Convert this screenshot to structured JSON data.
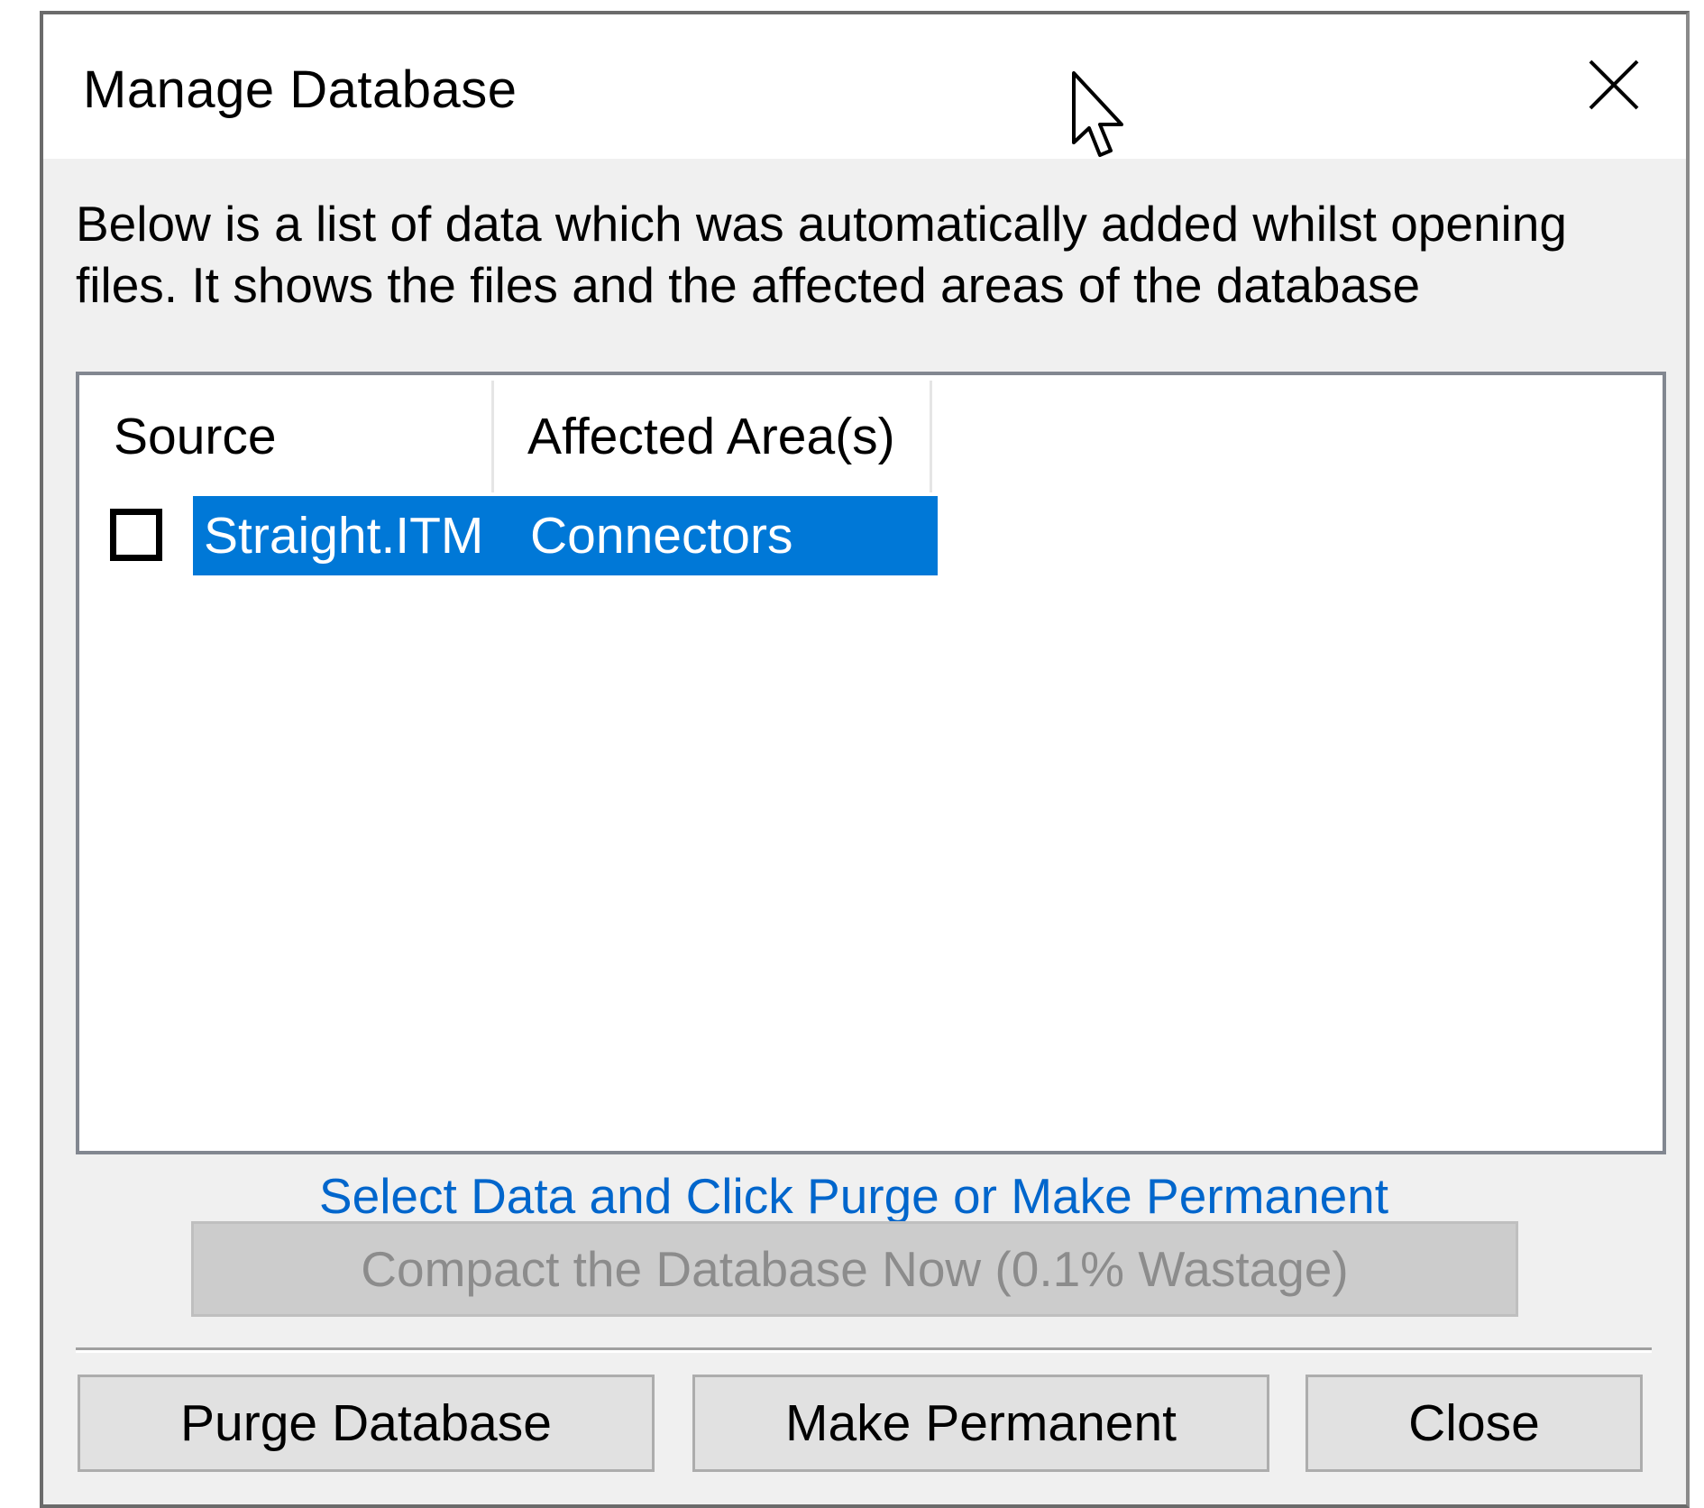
{
  "dialog": {
    "title": "Manage Database",
    "description": "Below is a list of data which was automatically added whilst opening\nfiles. It shows the files and the affected areas of the database"
  },
  "list": {
    "columns": [
      "Source",
      "Affected Area(s)"
    ],
    "rows": [
      {
        "checked": false,
        "source": "Straight.ITM",
        "area": "Connectors",
        "selected": true
      }
    ]
  },
  "hint": "Select Data and Click Purge or Make Permanent",
  "compact_button": {
    "label": "Compact the Database Now (0.1% Wastage)",
    "enabled": false
  },
  "buttons": {
    "purge": "Purge Database",
    "permanent": "Make Permanent",
    "close": "Close"
  },
  "colors": {
    "selection": "#0078d7",
    "hint_link": "#0066cc",
    "dialog_bg": "#f0f0f0"
  },
  "icons": [
    "close-icon",
    "mouse-cursor-icon"
  ]
}
